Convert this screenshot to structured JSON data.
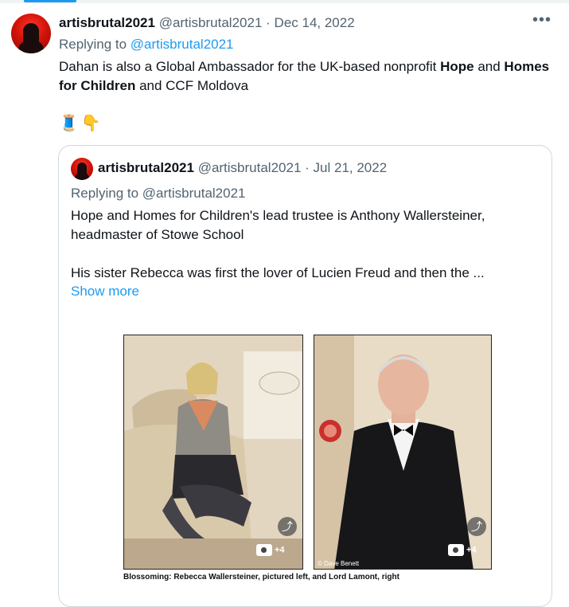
{
  "tweet": {
    "display_name": "artisbrutal2021",
    "handle": "@artisbrutal2021",
    "separator": "·",
    "date": "Dec 14, 2022",
    "more_icon": "more-horizontal-icon",
    "replying_prefix": "Replying to",
    "replying_handle": "@artisbrutal2021",
    "text_1": "Dahan is also a Global Ambassador for the UK-based nonprofit ",
    "text_bold_1": "Hope",
    "text_2": " and ",
    "text_bold_2": "Homes for Children",
    "text_3": " and CCF Moldova",
    "emoji_1": "🧵",
    "emoji_2": "👇"
  },
  "quote": {
    "display_name": "artisbrutal2021",
    "handle": "@artisbrutal2021",
    "separator": "·",
    "date": "Jul 21, 2022",
    "replying_line": "Replying to @artisbrutal2021",
    "paragraph_1": "Hope and Homes for Children's lead trustee is Anthony Wallersteiner, headmaster of Stowe School",
    "paragraph_2": "His sister Rebecca was first the lover of Lucien Freud and then the ...",
    "show_more": "Show more"
  },
  "media": {
    "caption": "Blossoming: Rebecca Wallersteiner, pictured left, and Lord Lamont, right",
    "photo_credit": "© Dave Benett",
    "left_count": "+4",
    "right_count": "+4",
    "share_icon": "share-icon",
    "camera_icon": "camera-icon"
  },
  "colors": {
    "accent": "#1d9bf0",
    "muted": "#536471",
    "border": "#cfd9de",
    "text": "#0f1419"
  }
}
